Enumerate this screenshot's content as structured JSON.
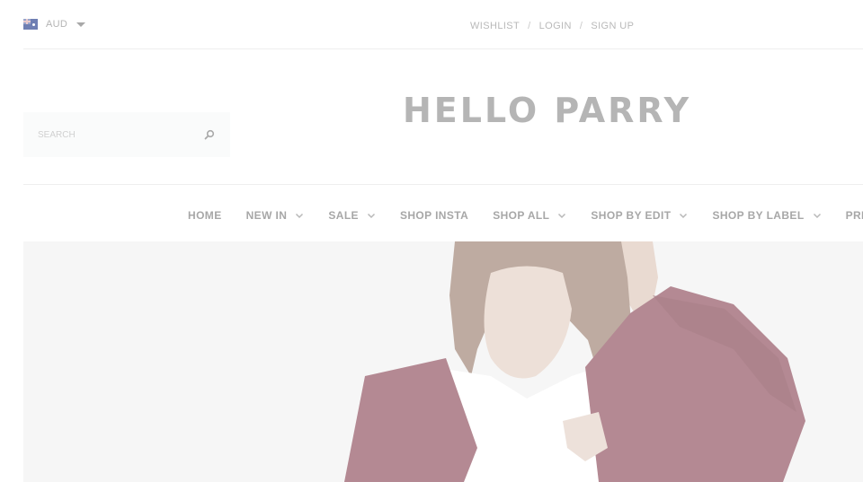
{
  "topbar": {
    "currency": {
      "code": "AUD",
      "flag_icon": "australia-flag-icon"
    },
    "links": [
      {
        "label": "WISHLIST"
      },
      {
        "label": "LOGIN"
      },
      {
        "label": "SIGN UP"
      }
    ],
    "separator": "/"
  },
  "search": {
    "placeholder": "SEARCH",
    "value": "",
    "icon": "search-icon"
  },
  "brand": {
    "logo_text": "HELLO PARRY"
  },
  "nav": {
    "items": [
      {
        "label": "HOME",
        "has_dropdown": false
      },
      {
        "label": "NEW IN",
        "has_dropdown": true
      },
      {
        "label": "SALE",
        "has_dropdown": true
      },
      {
        "label": "SHOP INSTA",
        "has_dropdown": false
      },
      {
        "label": "SHOP ALL",
        "has_dropdown": true
      },
      {
        "label": "SHOP BY EDIT",
        "has_dropdown": true
      },
      {
        "label": "SHOP BY LABEL",
        "has_dropdown": true
      },
      {
        "label": "PRESS",
        "has_dropdown": false
      }
    ]
  },
  "hero": {
    "colors": {
      "background": "#f1f1f1",
      "cardigan": "#7d3747",
      "tee": "#ffffff",
      "hair": "#8a6a58",
      "skin": "#d8b9a6"
    }
  }
}
